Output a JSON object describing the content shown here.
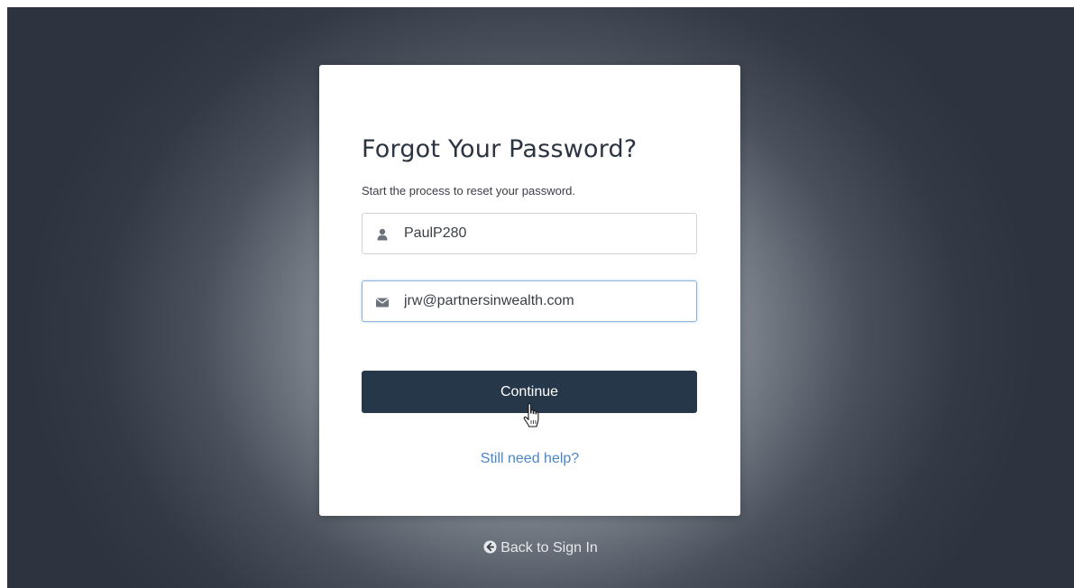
{
  "card": {
    "title": "Forgot Your Password?",
    "subtitle": "Start the process to reset your password."
  },
  "username": {
    "icon": "user-icon",
    "value": "PaulP280"
  },
  "email": {
    "icon": "envelope-icon",
    "value": "jrw@partnersinwealth.com"
  },
  "continue_label": "Continue",
  "help_link": "Still need help?",
  "back_link": {
    "icon": "circle-arrow-left-icon",
    "label": "Back to Sign In"
  },
  "colors": {
    "button": "#26374a",
    "link": "#4a86c5",
    "title": "#2b3440"
  }
}
